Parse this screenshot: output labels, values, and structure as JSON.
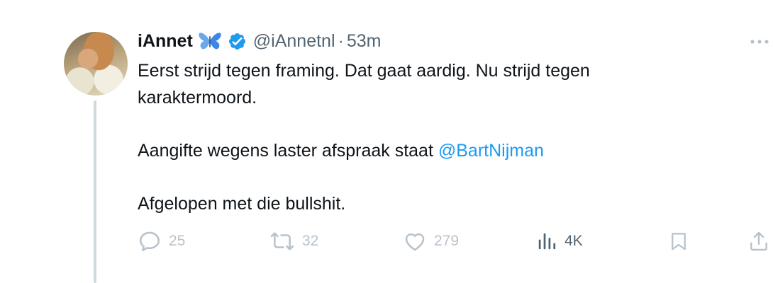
{
  "tweet": {
    "author": {
      "name": "iAnnet",
      "handle": "@iAnnetnl",
      "badge_emoji_icon": "butterfly-icon",
      "verified_icon": "verified-badge-icon"
    },
    "separator": "·",
    "time": "53m",
    "text": {
      "line1_a": "Eerst strijd tegen framing. Dat gaat aardig. Nu strijd tegen",
      "line1_b": "karaktermoord.",
      "line2_prefix": "Aangifte wegens laster afspraak staat ",
      "line2_mention": "@BartNijman",
      "line3": "Afgelopen met die bullshit."
    },
    "actions": {
      "replies": "25",
      "retweets": "32",
      "likes": "279",
      "views": "4K"
    }
  },
  "colors": {
    "text": "#0f1419",
    "secondary": "#536471",
    "muted": "#b8c2ca",
    "link": "#1d9bf0",
    "verified": "#1d9bf0",
    "thread_line": "#cfd9de"
  }
}
